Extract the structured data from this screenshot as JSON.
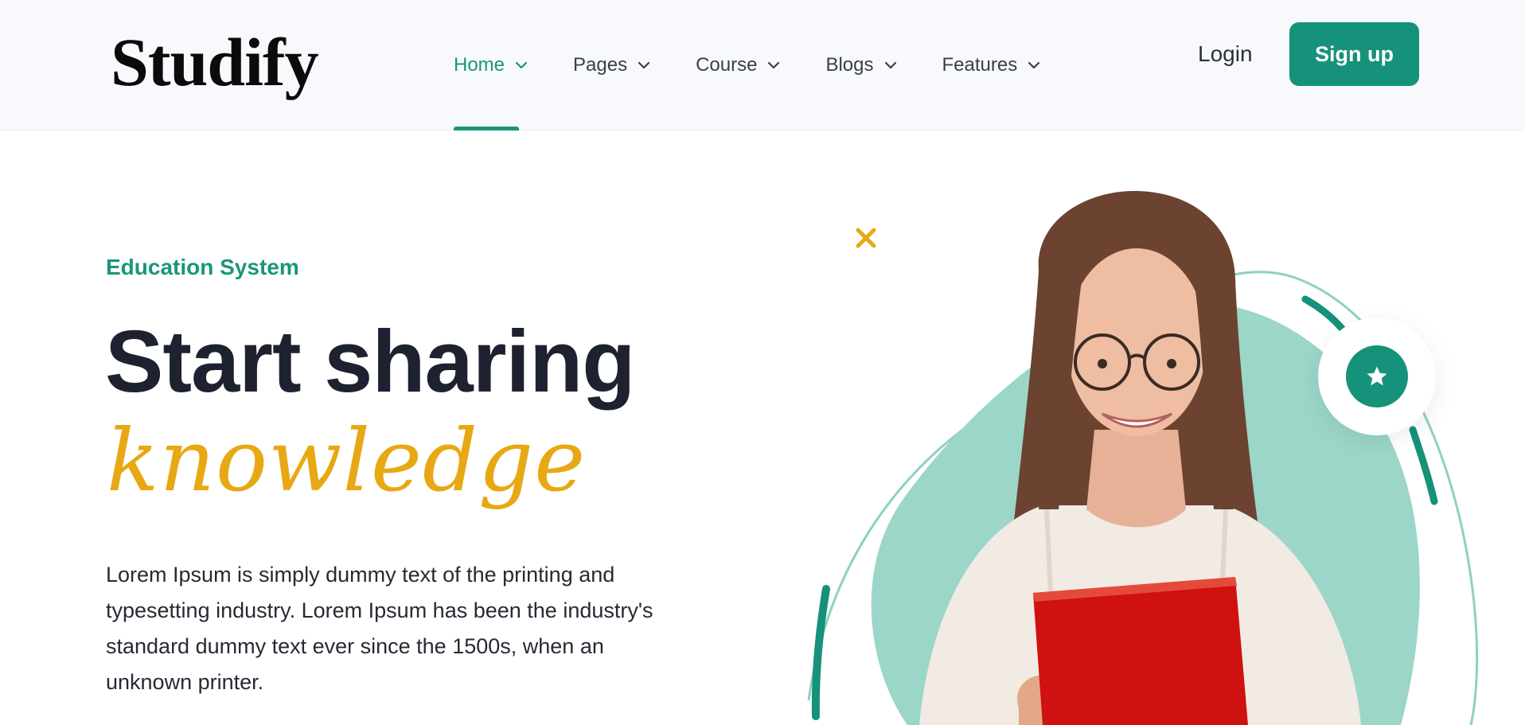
{
  "brand": {
    "logo_text": "Studify"
  },
  "nav": {
    "items": [
      {
        "label": "Home",
        "active": true
      },
      {
        "label": "Pages",
        "active": false
      },
      {
        "label": "Course",
        "active": false
      },
      {
        "label": "Blogs",
        "active": false
      },
      {
        "label": "Features",
        "active": false
      }
    ],
    "login_label": "Login",
    "signup_label": "Sign up"
  },
  "hero": {
    "eyebrow": "Education System",
    "headline": "Start sharing",
    "headline_script": "knowledge",
    "lead": "Lorem Ipsum is simply dummy text of the printing and typesetting industry. Lorem Ipsum has been the industry's standard dummy text ever since the 1500s, when an unknown printer."
  },
  "colors": {
    "accent": "#16917a",
    "highlight": "#e8a813",
    "blob": "#9bd6c8",
    "book": "#cf1111"
  },
  "icons": {
    "nav_chevron": "chevron-down-icon",
    "star": "star-icon",
    "sparkle": "close-icon"
  }
}
